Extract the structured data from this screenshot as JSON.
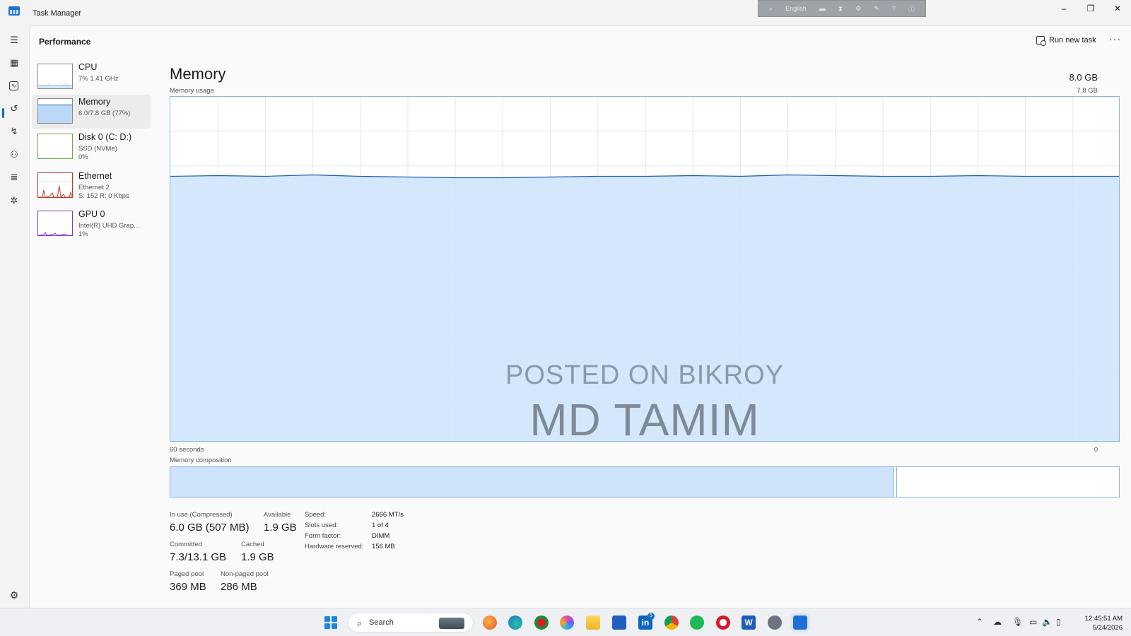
{
  "window": {
    "title": "Task Manager",
    "language_bar_label": "English",
    "minimize": "–",
    "restore": "❐",
    "close": "✕"
  },
  "header": {
    "page_title": "Performance",
    "run_new_task": "Run new task",
    "more": "···"
  },
  "devices": [
    {
      "name": "CPU",
      "sub1": "7% 1.41 GHz",
      "sub2": ""
    },
    {
      "name": "Memory",
      "sub1": "6.0/7.8 GB (77%)",
      "sub2": ""
    },
    {
      "name": "Disk 0 (C: D:)",
      "sub1": "SSD (NVMe)",
      "sub2": "0%"
    },
    {
      "name": "Ethernet",
      "sub1": "Ethernet 2",
      "sub2": "S: 152 R: 0 Kbps"
    },
    {
      "name": "GPU 0",
      "sub1": "Intel(R) UHD Grap...",
      "sub2": "1%"
    }
  ],
  "memory": {
    "title": "Memory",
    "total": "8.0 GB",
    "usage_label": "Memory usage",
    "usage_max": "7.8 GB",
    "axis_left": "60 seconds",
    "axis_right": "0",
    "composition_label": "Memory composition",
    "usage_fraction": 0.77,
    "composition_inuse_fraction": 0.762,
    "watermark_line1": "POSTED ON BIKROY",
    "watermark_line2": "MD TAMIM"
  },
  "stats": {
    "in_use_label": "In use (Compressed)",
    "in_use_value": "6.0 GB (507 MB)",
    "available_label": "Available",
    "available_value": "1.9 GB",
    "committed_label": "Committed",
    "committed_value": "7.3/13.1 GB",
    "cached_label": "Cached",
    "cached_value": "1.9 GB",
    "paged_label": "Paged pool",
    "paged_value": "369 MB",
    "nonpaged_label": "Non-paged pool",
    "nonpaged_value": "286 MB"
  },
  "properties": [
    {
      "label": "Speed:",
      "value": "2666 MT/s"
    },
    {
      "label": "Slots used:",
      "value": "1 of 4"
    },
    {
      "label": "Form factor:",
      "value": "DIMM"
    },
    {
      "label": "Hardware reserved:",
      "value": "156 MB"
    }
  ],
  "taskbar": {
    "search_placeholder": "Search",
    "linkedin_badge": "5",
    "time": "12:45:51 AM",
    "date": "5/24/2026"
  },
  "colors": {
    "accent": "#0f6cbd",
    "graph_fill": "#cfe4fb",
    "graph_line": "#1a5fb4",
    "graph_border": "#8ab4e6",
    "ethernet": "#c0392b",
    "gpu": "#7d3cc9"
  }
}
